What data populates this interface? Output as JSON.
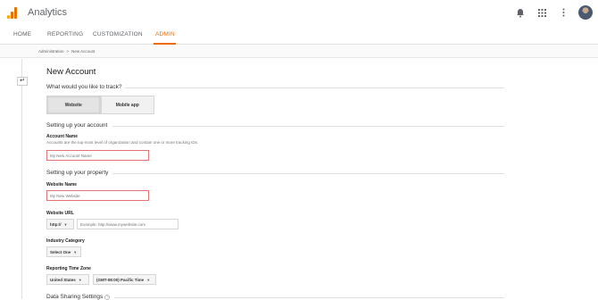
{
  "app": {
    "title": "Analytics",
    "logo_colors": [
      "#f9ab00",
      "#e37400",
      "#e37400"
    ]
  },
  "nav": {
    "tabs": [
      {
        "label": "HOME"
      },
      {
        "label": "REPORTING"
      },
      {
        "label": "CUSTOMIZATION"
      },
      {
        "label": "ADMIN",
        "active": true
      }
    ]
  },
  "breadcrumb": {
    "root": "Administration",
    "sep": ">",
    "current": "New Account"
  },
  "page": {
    "title": "New Account",
    "track_question": "What would you like to track?",
    "track_options": [
      "Website",
      "Mobile app"
    ],
    "account_section": "Setting up your account",
    "account_name_label": "Account Name",
    "account_name_help": "Accounts are the top-most level of organization and contain one or more tracking IDs.",
    "account_name_placeholder": "My New Account Name",
    "property_section": "Setting up your property",
    "website_name_label": "Website Name",
    "website_name_placeholder": "My New Website",
    "website_url_label": "Website URL",
    "url_protocol": "http://",
    "url_placeholder": "Example: http://www.mywebsite.com",
    "industry_label": "Industry Category",
    "industry_value": "Select One",
    "timezone_label": "Reporting Time Zone",
    "country_value": "United States",
    "timezone_value": "(GMT-08:00) Pacific Time",
    "data_sharing": "Data Sharing Settings"
  },
  "icons": {
    "back": "back-arrow-icon",
    "notifications": "bell-icon",
    "apps": "apps-grid-icon",
    "more": "more-vert-icon"
  },
  "colors": {
    "accent": "#ef6c00",
    "error_border": "#e57373"
  }
}
